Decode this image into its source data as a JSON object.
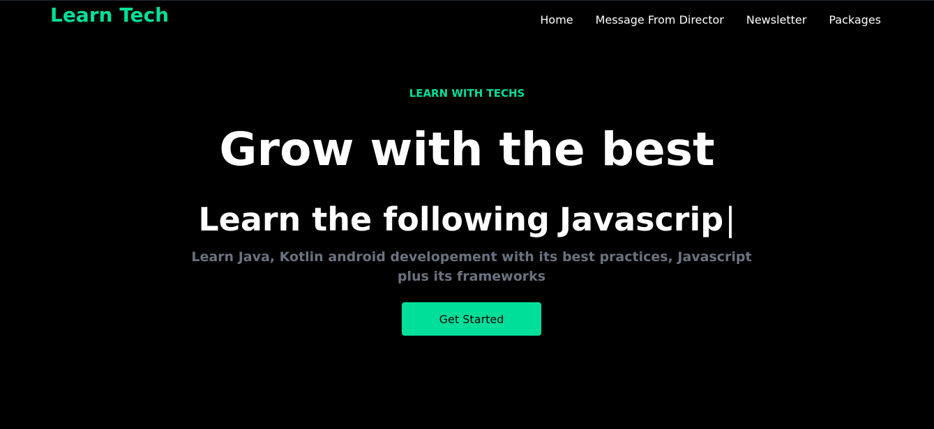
{
  "brand": {
    "name": "Learn Tech",
    "color": "#00df9a"
  },
  "nav": {
    "items": [
      {
        "label": "Home"
      },
      {
        "label": "Message From Director"
      },
      {
        "label": "Newsletter"
      },
      {
        "label": "Packages"
      }
    ]
  },
  "hero": {
    "eyebrow": "LEARN WITH TECHS",
    "headline": "Grow with the best",
    "typed_prefix": "Learn the following",
    "typed_word": "Javascrip",
    "cursor": "|",
    "description": "Learn Java, Kotlin android developement with its best practices, Javascript plus its frameworks",
    "cta_label": "Get Started"
  },
  "colors": {
    "background": "#000000",
    "accent": "#00df9a",
    "muted_text": "#6b7280",
    "text": "#ffffff"
  }
}
